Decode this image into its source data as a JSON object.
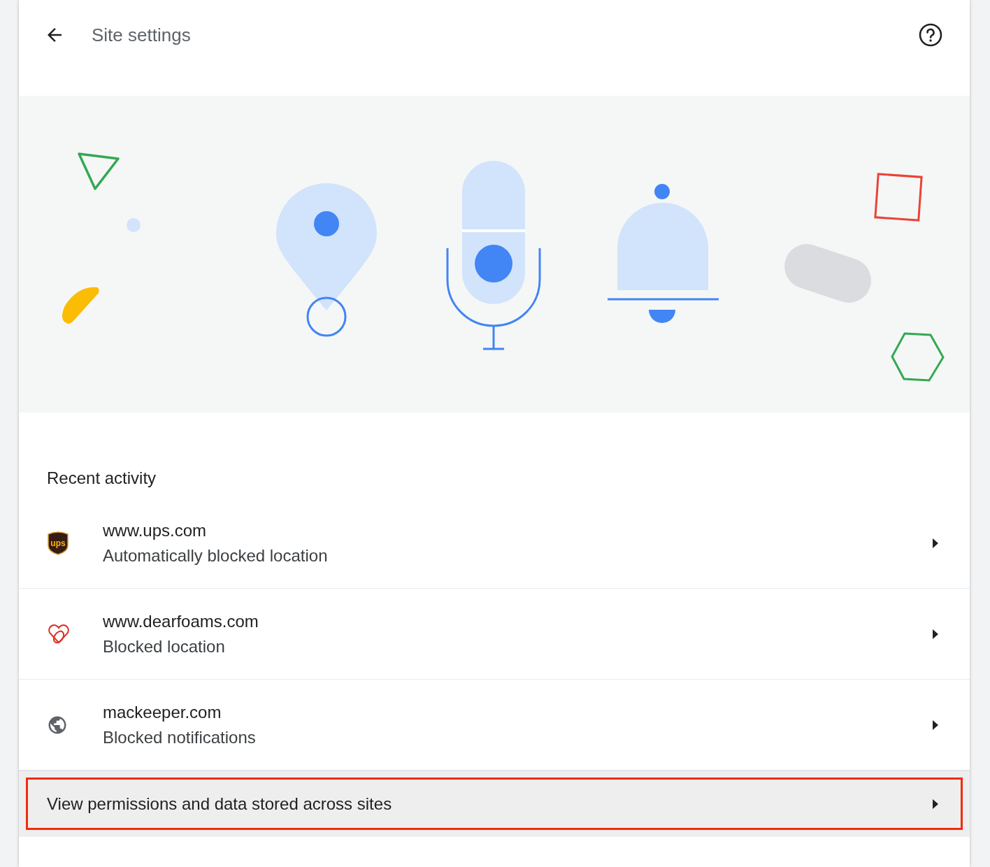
{
  "header": {
    "title": "Site settings"
  },
  "section": {
    "title": "Recent activity"
  },
  "sites": [
    {
      "kind": "ups",
      "logo_text": "ups",
      "domain": "www.ups.com",
      "detail": "Automatically blocked location"
    },
    {
      "kind": "heart",
      "domain": "www.dearfoams.com",
      "detail": "Blocked location"
    },
    {
      "kind": "globe",
      "domain": "mackeeper.com",
      "detail": "Blocked notifications"
    }
  ],
  "link_row": {
    "label": "View permissions and data stored across sites",
    "highlighted": true
  }
}
